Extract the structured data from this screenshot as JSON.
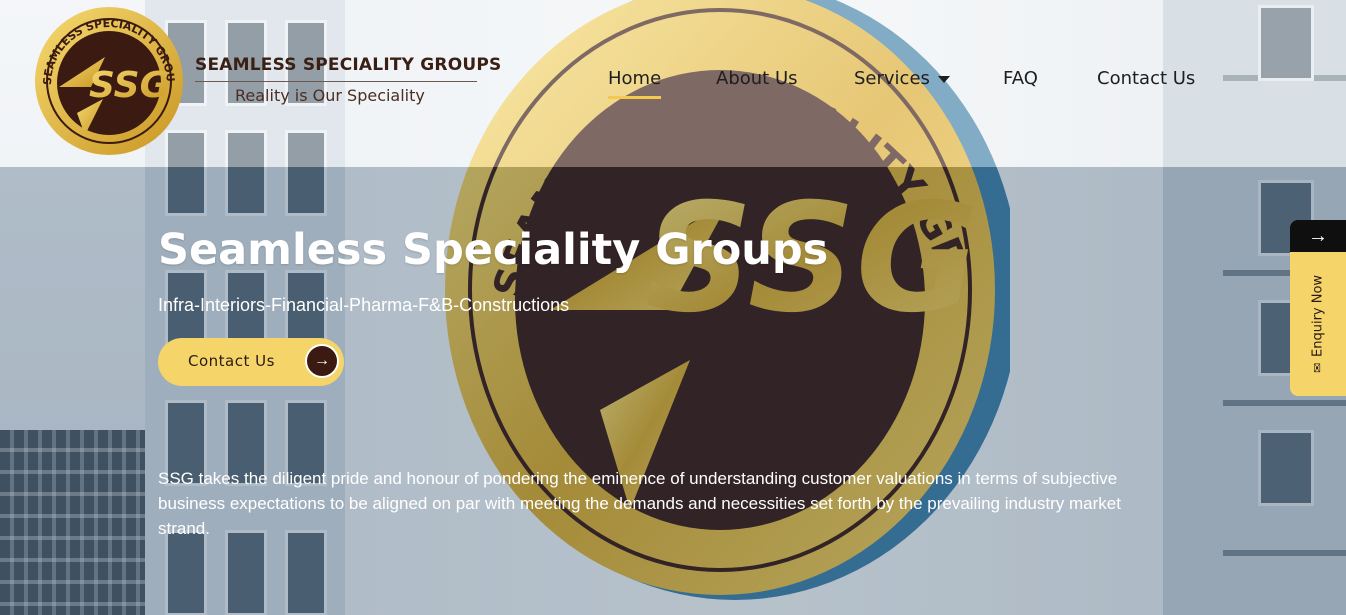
{
  "brand": {
    "logo_text": "SSG",
    "logo_ring_text": "SEAMLESS SPECIALITY GROUPS",
    "name": "SEAMLESS SPECIALITY GROUPS",
    "tagline": "Reality is Our Speciality"
  },
  "nav": {
    "items": [
      {
        "label": "Home",
        "active": true
      },
      {
        "label": "About Us"
      },
      {
        "label": "Services",
        "has_dropdown": true
      },
      {
        "label": "FAQ"
      },
      {
        "label": "Contact Us"
      }
    ]
  },
  "hero": {
    "title": "Seamless Speciality Groups",
    "subtitle": "Infra-Interiors-Financial-Pharma-F&B-Constructions",
    "cta_label": "Contact Us",
    "cta_icon": "arrow-right-icon",
    "description": "SSG takes the diligent pride and honour of pondering the eminence of understanding customer valuations in terms of subjective business expectations to be aligned on par with meeting the demands and necessities set forth by the prevailing industry market strand."
  },
  "sign": {
    "ring_text": "SEAMLESS SPECIALITY GROUPS",
    "center_text": "SSG"
  },
  "enquiry": {
    "arrow": "→",
    "label": "Enquiry Now",
    "icon": "mail-icon"
  },
  "colors": {
    "accent_gold": "#f5d56a",
    "brand_brown": "#3b1a12",
    "nav_underline": "#f5c94d"
  }
}
